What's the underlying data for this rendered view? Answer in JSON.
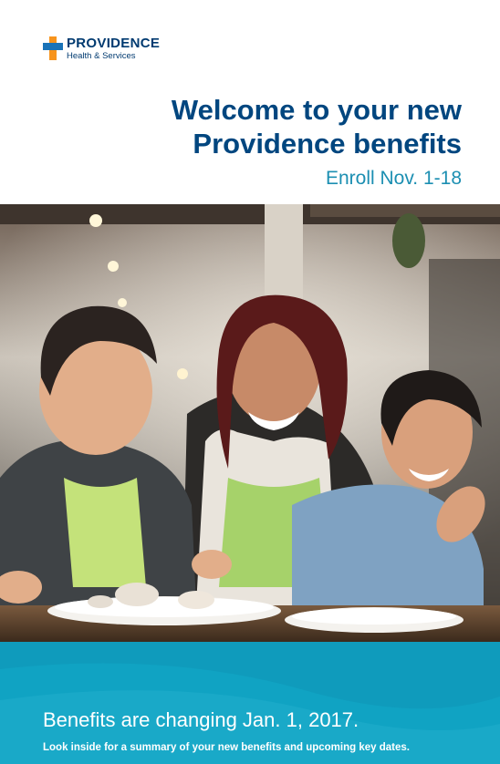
{
  "logo": {
    "name": "PROVIDENCE",
    "subname": "Health & Services",
    "cross_color_vertical": "#f7941d",
    "cross_color_horizontal": "#1a73b8"
  },
  "hero": {
    "title_line1": "Welcome to your new",
    "title_line2": "Providence benefits",
    "subtitle": "Enroll Nov. 1-18"
  },
  "footer": {
    "headline": "Benefits are changing Jan. 1, 2017.",
    "note": "Look inside for a summary of your new benefits and upcoming key dates."
  },
  "colors": {
    "title": "#00467f",
    "subtitle": "#1c8fb2",
    "band": "#10a3c3"
  }
}
